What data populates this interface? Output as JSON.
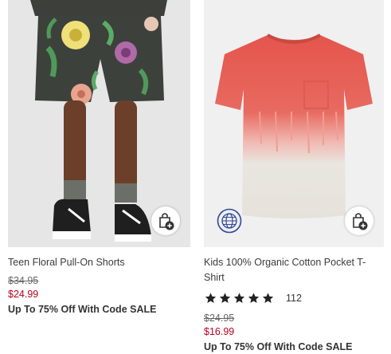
{
  "products": [
    {
      "name": "Teen Floral Pull-On Shorts",
      "original_price": "$34.95",
      "sale_price": "$24.99",
      "promo": "Up To 75% Off With Code SALE",
      "quick_add_icon": "bag-plus-icon"
    },
    {
      "name": "Kids 100% Organic Cotton Pocket T-Shirt",
      "rating": 5,
      "review_count": "112",
      "original_price": "$24.95",
      "sale_price": "$16.99",
      "promo": "Up To 75% Off With Code SALE",
      "badge_icon": "globe-sustainability-icon",
      "quick_add_icon": "bag-plus-icon"
    }
  ],
  "colors": {
    "sale_price": "#b8001f",
    "badge": "#2f4a9a",
    "text": "#333333"
  }
}
